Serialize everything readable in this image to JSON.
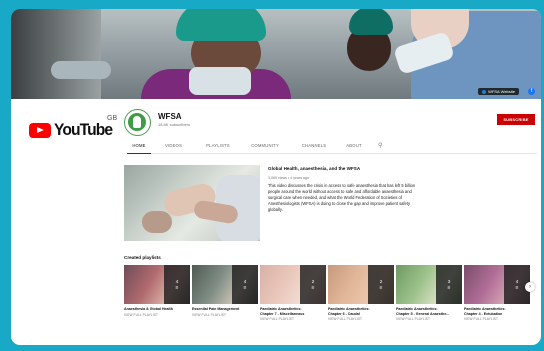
{
  "banner": {
    "website_link": "WFSA Website",
    "fb_glyph": "f"
  },
  "youtube": {
    "wordmark": "YouTube",
    "region": "GB"
  },
  "channel": {
    "name": "WFSA",
    "subscribers": "18.8K subscribers",
    "subscribe_label": "SUBSCRIBE"
  },
  "tabs": [
    {
      "label": "HOME",
      "active": true
    },
    {
      "label": "VIDEOS",
      "active": false
    },
    {
      "label": "PLAYLISTS",
      "active": false
    },
    {
      "label": "COMMUNITY",
      "active": false
    },
    {
      "label": "CHANNELS",
      "active": false
    },
    {
      "label": "ABOUT",
      "active": false
    }
  ],
  "search_icon_glyph": "⚲",
  "featured_video": {
    "title": "Global Health, anaesthesia, and the WFSA",
    "meta": "3,069 views • 4 years ago",
    "description": "This video discusses the crisis in access to safe anaesthesia that has left 5 billion people around the world without access to safe and affordable anaesthesia and surgical care when needed, and what the World Federation of Societies of Anesthesiologists (WFSA) is doing to close the gap and improve patient safety globally."
  },
  "playlists_section": {
    "title": "Created playlists",
    "view_label": "VIEW FULL PLAYLIST",
    "items": [
      {
        "count": "4",
        "title1": "Anaesthesia & Global Health",
        "title2": ""
      },
      {
        "count": "4",
        "title1": "Essential Pain Management",
        "title2": ""
      },
      {
        "count": "2",
        "title1": "Paediatric Anaesthetics:",
        "title2": "Chapter 7 - Miscellaneous"
      },
      {
        "count": "2",
        "title1": "Paediatric Anaesthetics:",
        "title2": "Chapter 6 - Caudal"
      },
      {
        "count": "3",
        "title1": "Paediatric Anaesthetics:",
        "title2": "Chapter 5 - General Anaesthe..."
      },
      {
        "count": "4",
        "title1": "Paediatric Anaesthetics:",
        "title2": "Chapter 4 - Extubation"
      }
    ]
  },
  "colors": {
    "background": "#17a9c5",
    "subscribe": "#cc0000",
    "youtube_red": "#ff0000"
  }
}
